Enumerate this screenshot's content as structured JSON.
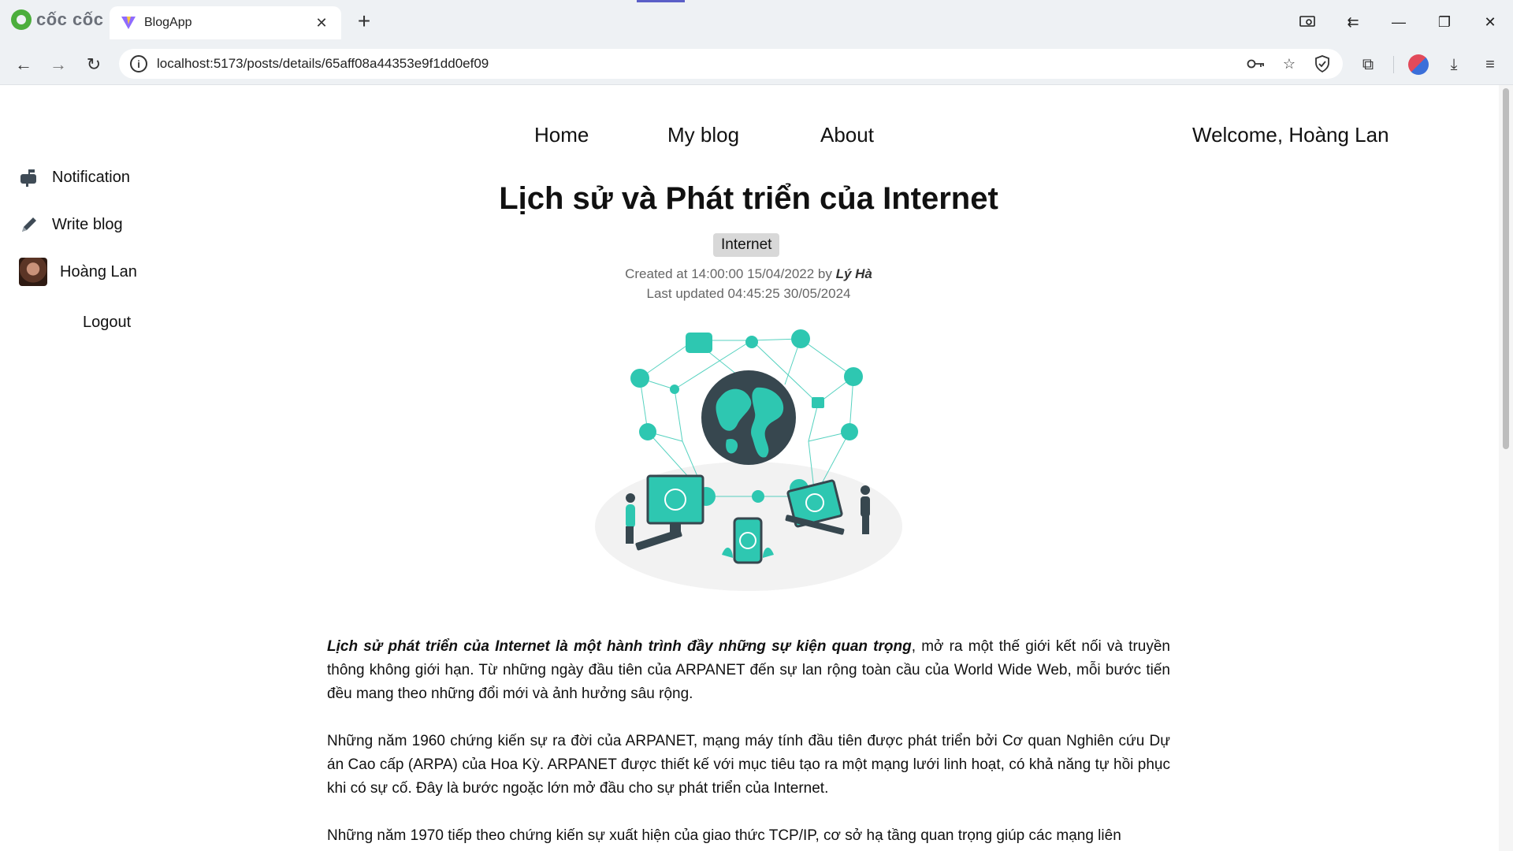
{
  "browser": {
    "brand": "cốc cốc",
    "tab": {
      "title": "BlogApp",
      "close": "✕"
    },
    "new_tab": "+",
    "url": "localhost:5173/posts/details/65aff08a44353e9f1dd0ef09",
    "window_controls": {
      "minimize": "—",
      "maximize": "❐",
      "close": "✕"
    }
  },
  "nav": {
    "home": "Home",
    "my_blog": "My blog",
    "about": "About",
    "welcome": "Welcome, Hoàng Lan"
  },
  "sidebar": {
    "notification": "Notification",
    "write_blog": "Write blog",
    "user_name": "Hoàng Lan",
    "logout": "Logout"
  },
  "post": {
    "title": "Lịch sử và Phát triển của Internet",
    "tag": "Internet",
    "created_prefix": "Created at 14:00:00 15/04/2022 by ",
    "author": "Lý Hà",
    "updated": "Last updated 04:45:25 30/05/2024",
    "lead_bold": "Lịch sử phát triển của Internet là một hành trình đầy những sự kiện quan trọng",
    "lead_rest": ", mở ra một thế giới kết nối và truyền thông không giới hạn. Từ những ngày đầu tiên của ARPANET đến sự lan rộng toàn cầu của World Wide Web, mỗi bước tiến đều mang theo những đổi mới và ảnh hưởng sâu rộng.",
    "para2": "Những năm 1960 chứng kiến sự ra đời của ARPANET, mạng máy tính đầu tiên được phát triển bởi Cơ quan Nghiên cứu Dự án Cao cấp (ARPA) của Hoa Kỳ. ARPANET được thiết kế với mục tiêu tạo ra một mạng lưới linh hoạt, có khả năng tự hồi phục khi có sự cố. Đây là bước ngoặc lớn mở đầu cho sự phát triển của Internet.",
    "para3": "Những năm 1970 tiếp theo chứng kiến sự xuất hiện của giao thức TCP/IP, cơ sở hạ tầng quan trọng giúp các mạng liên"
  },
  "colors": {
    "accent": "#2ec7b1",
    "globe": "#37474f",
    "chrome_bg": "#eef1f4"
  }
}
